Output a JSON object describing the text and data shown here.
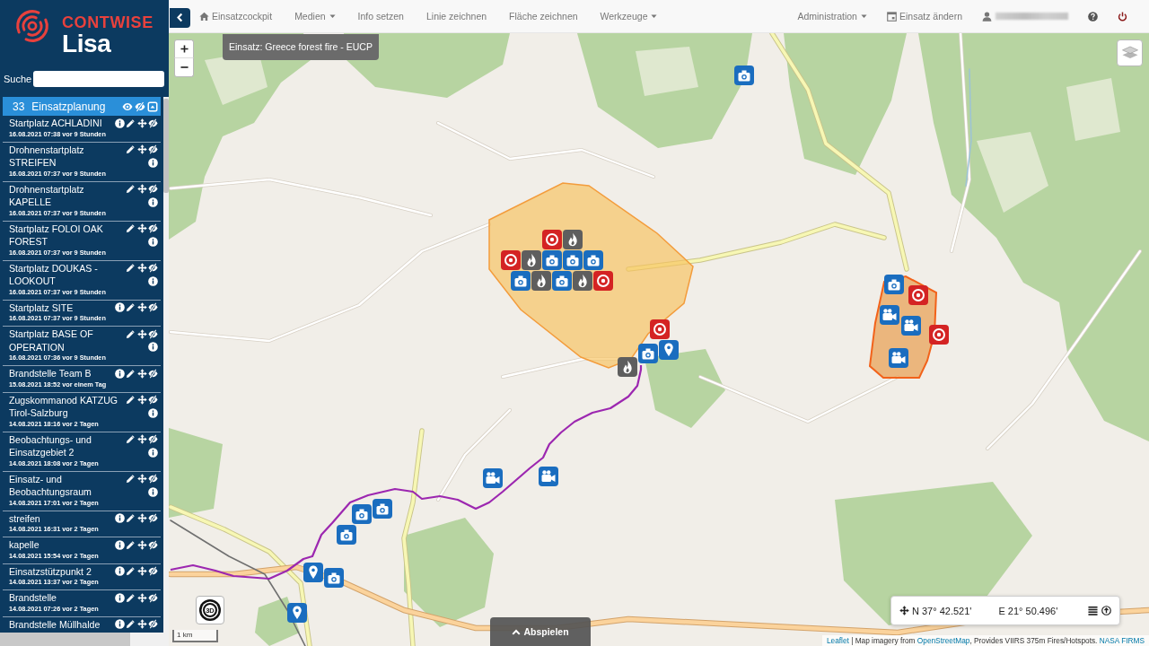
{
  "sidebar": {
    "brand": "CONTWISE",
    "product": "Lisa",
    "search": {
      "label": "Suche"
    },
    "list": {
      "count": "33",
      "title": "Einsatzplanung",
      "items": [
        {
          "name": "Startplatz ACHLADINI",
          "timestamp": "16.08.2021 07:38 vor 9 Stunden"
        },
        {
          "name": "Drohnenstartplatz STREIFEN",
          "timestamp": "16.08.2021 07:37 vor 9 Stunden"
        },
        {
          "name": "Drohnenstartplatz KAPELLE",
          "timestamp": "16.08.2021 07:37 vor 9 Stunden"
        },
        {
          "name": "Startplatz FOLOI OAK FOREST",
          "timestamp": "16.08.2021 07:37 vor 9 Stunden"
        },
        {
          "name": "Startplatz DOUKAS - LOOKOUT",
          "timestamp": "16.08.2021 07:37 vor 9 Stunden"
        },
        {
          "name": "Startplatz SITE",
          "timestamp": "16.08.2021 07:37 vor 9 Stunden"
        },
        {
          "name": "Startplatz BASE OF OPERATION",
          "timestamp": "16.08.2021 07:36 vor 9 Stunden"
        },
        {
          "name": "Brandstelle Team B",
          "timestamp": "15.08.2021 18:52 vor einem Tag"
        },
        {
          "name": "Zugskommanod KATZUG Tirol-Salzburg",
          "timestamp": "14.08.2021 18:16 vor 2 Tagen"
        },
        {
          "name": "Beobachtungs- und Einsatzgebiet 2",
          "timestamp": "14.08.2021 18:08 vor 2 Tagen"
        },
        {
          "name": "Einsatz- und Beobachtungsraum",
          "timestamp": "14.08.2021 17:01 vor 2 Tagen"
        },
        {
          "name": "streifen",
          "timestamp": "14.08.2021 16:31 vor 2 Tagen"
        },
        {
          "name": "kapelle",
          "timestamp": "14.08.2021 15:54 vor 2 Tagen"
        },
        {
          "name": "Einsatzstützpunkt 2",
          "timestamp": "14.08.2021 13:37 vor 2 Tagen"
        },
        {
          "name": "Brandstelle",
          "timestamp": "14.08.2021 07:26 vor 2 Tagen"
        },
        {
          "name": "Brandstelle Müllhalde"
        }
      ]
    }
  },
  "navbar": {
    "left": [
      {
        "label": "Einsatzcockpit",
        "kind": "home"
      },
      {
        "label": "Medien",
        "kind": "dropdown"
      },
      {
        "label": "Info setzen",
        "kind": "link"
      },
      {
        "label": "Linie zeichnen",
        "kind": "link"
      },
      {
        "label": "Fläche zeichnen",
        "kind": "link"
      },
      {
        "label": "Werkzeuge",
        "kind": "dropdown"
      }
    ],
    "right": [
      {
        "label": "Administration",
        "kind": "dropdown"
      },
      {
        "label": "Einsatz ändern",
        "kind": "calendar"
      }
    ]
  },
  "map": {
    "mission": "Einsatz: Greece forest fire - EUCP",
    "view_3d": "3D",
    "scale": "1 km",
    "play": "Abspielen",
    "coordinates": {
      "north": "N 37° 42.521'",
      "east": "E 21° 50.496'"
    },
    "attribution": [
      {
        "kind": "link",
        "text": "Leaflet"
      },
      {
        "kind": "text",
        "text": " | Map imagery from "
      },
      {
        "kind": "link",
        "text": "OpenStreetMap"
      },
      {
        "kind": "text",
        "text": ", Provides VIIRS 375m Fires/Hotspots. "
      },
      {
        "kind": "link",
        "text": "NASA FIRMS"
      }
    ]
  }
}
